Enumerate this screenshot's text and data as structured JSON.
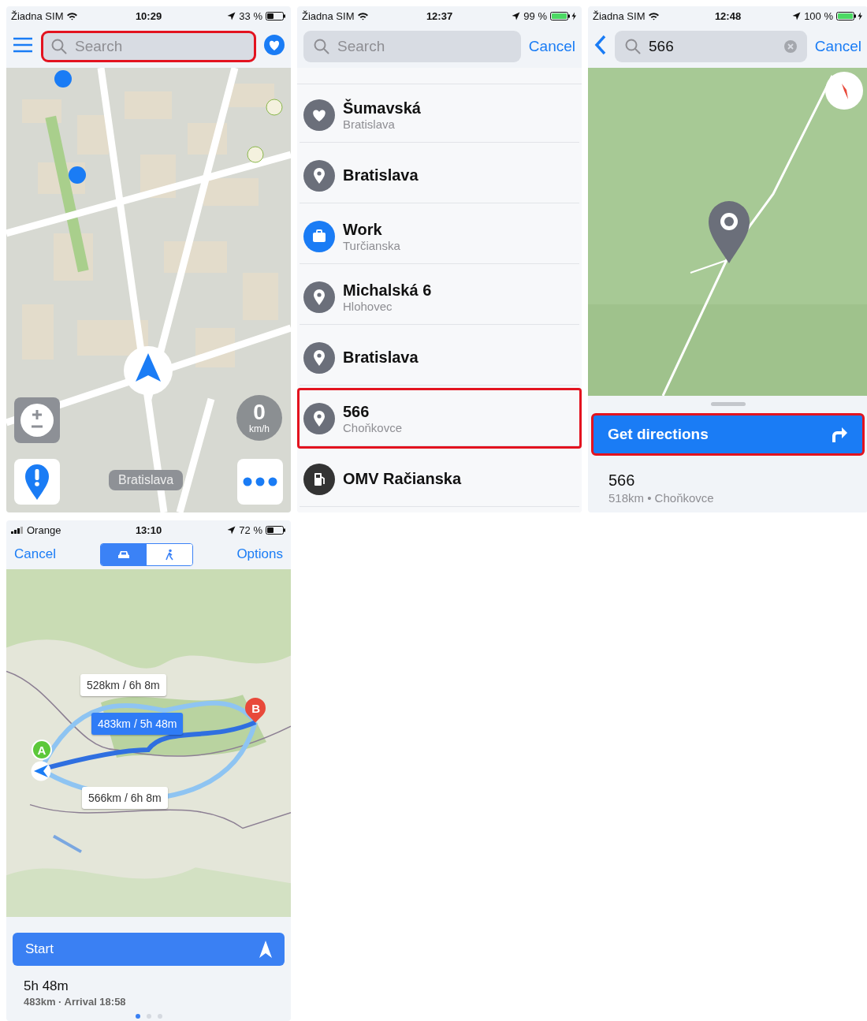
{
  "map_screen": {
    "status": {
      "carrier": "Žiadna SIM",
      "kind": "wifi",
      "time": "10:29",
      "battery": "33 %",
      "charging": false
    },
    "search": {
      "placeholder": "Search",
      "highlighted": true
    },
    "speed": {
      "value": "0",
      "unit": "km/h"
    },
    "location_label": "Bratislava"
  },
  "search_screen": {
    "status": {
      "carrier": "Žiadna SIM",
      "kind": "wifi",
      "time": "12:37",
      "battery": "99 %",
      "charging": true
    },
    "search": {
      "placeholder": "Search"
    },
    "cancel": "Cancel",
    "results": [
      {
        "kind": "heart",
        "title": "Šumavská",
        "subtitle": "Bratislava",
        "highlighted": false
      },
      {
        "kind": "pin",
        "title": "Bratislava",
        "highlighted": false
      },
      {
        "kind": "work",
        "title": "Work",
        "subtitle": "Turčianska",
        "highlighted": false
      },
      {
        "kind": "pin",
        "title": "Michalská 6",
        "subtitle": "Hlohovec",
        "highlighted": false
      },
      {
        "kind": "pin",
        "title": "Bratislava",
        "highlighted": false
      },
      {
        "kind": "pin",
        "title": "566",
        "subtitle": "Choňkovce",
        "highlighted": true
      },
      {
        "kind": "fuel",
        "title": "OMV Račianska",
        "highlighted": false
      }
    ]
  },
  "place_screen": {
    "status": {
      "carrier": "Žiadna SIM",
      "kind": "wifi",
      "time": "12:48",
      "battery": "100 %",
      "charging": true
    },
    "search": {
      "value": "566"
    },
    "cancel": "Cancel",
    "directions_button": {
      "label": "Get directions",
      "highlighted": true
    },
    "title": "566",
    "details": "518km • Choňkovce"
  },
  "route_screen": {
    "status": {
      "carrier": "Orange",
      "kind": "cellular",
      "time": "13:10",
      "battery": "72 %",
      "charging": false
    },
    "cancel": "Cancel",
    "modes": [
      {
        "kind": "car",
        "selected": true
      },
      {
        "kind": "walk",
        "selected": false
      }
    ],
    "options": "Options",
    "routes": [
      {
        "label": "528km / 6h 8m",
        "selected": false
      },
      {
        "label": "483km / 5h 48m",
        "selected": true
      },
      {
        "label": "566km / 6h 8m",
        "selected": false
      }
    ],
    "start_marker": "A",
    "end_marker": "B",
    "start_button": "Start",
    "duration": "5h 48m",
    "summary": "483km · Arrival 18:58",
    "pages": [
      {
        "selected": true
      },
      {
        "selected": false
      },
      {
        "selected": false
      }
    ]
  }
}
